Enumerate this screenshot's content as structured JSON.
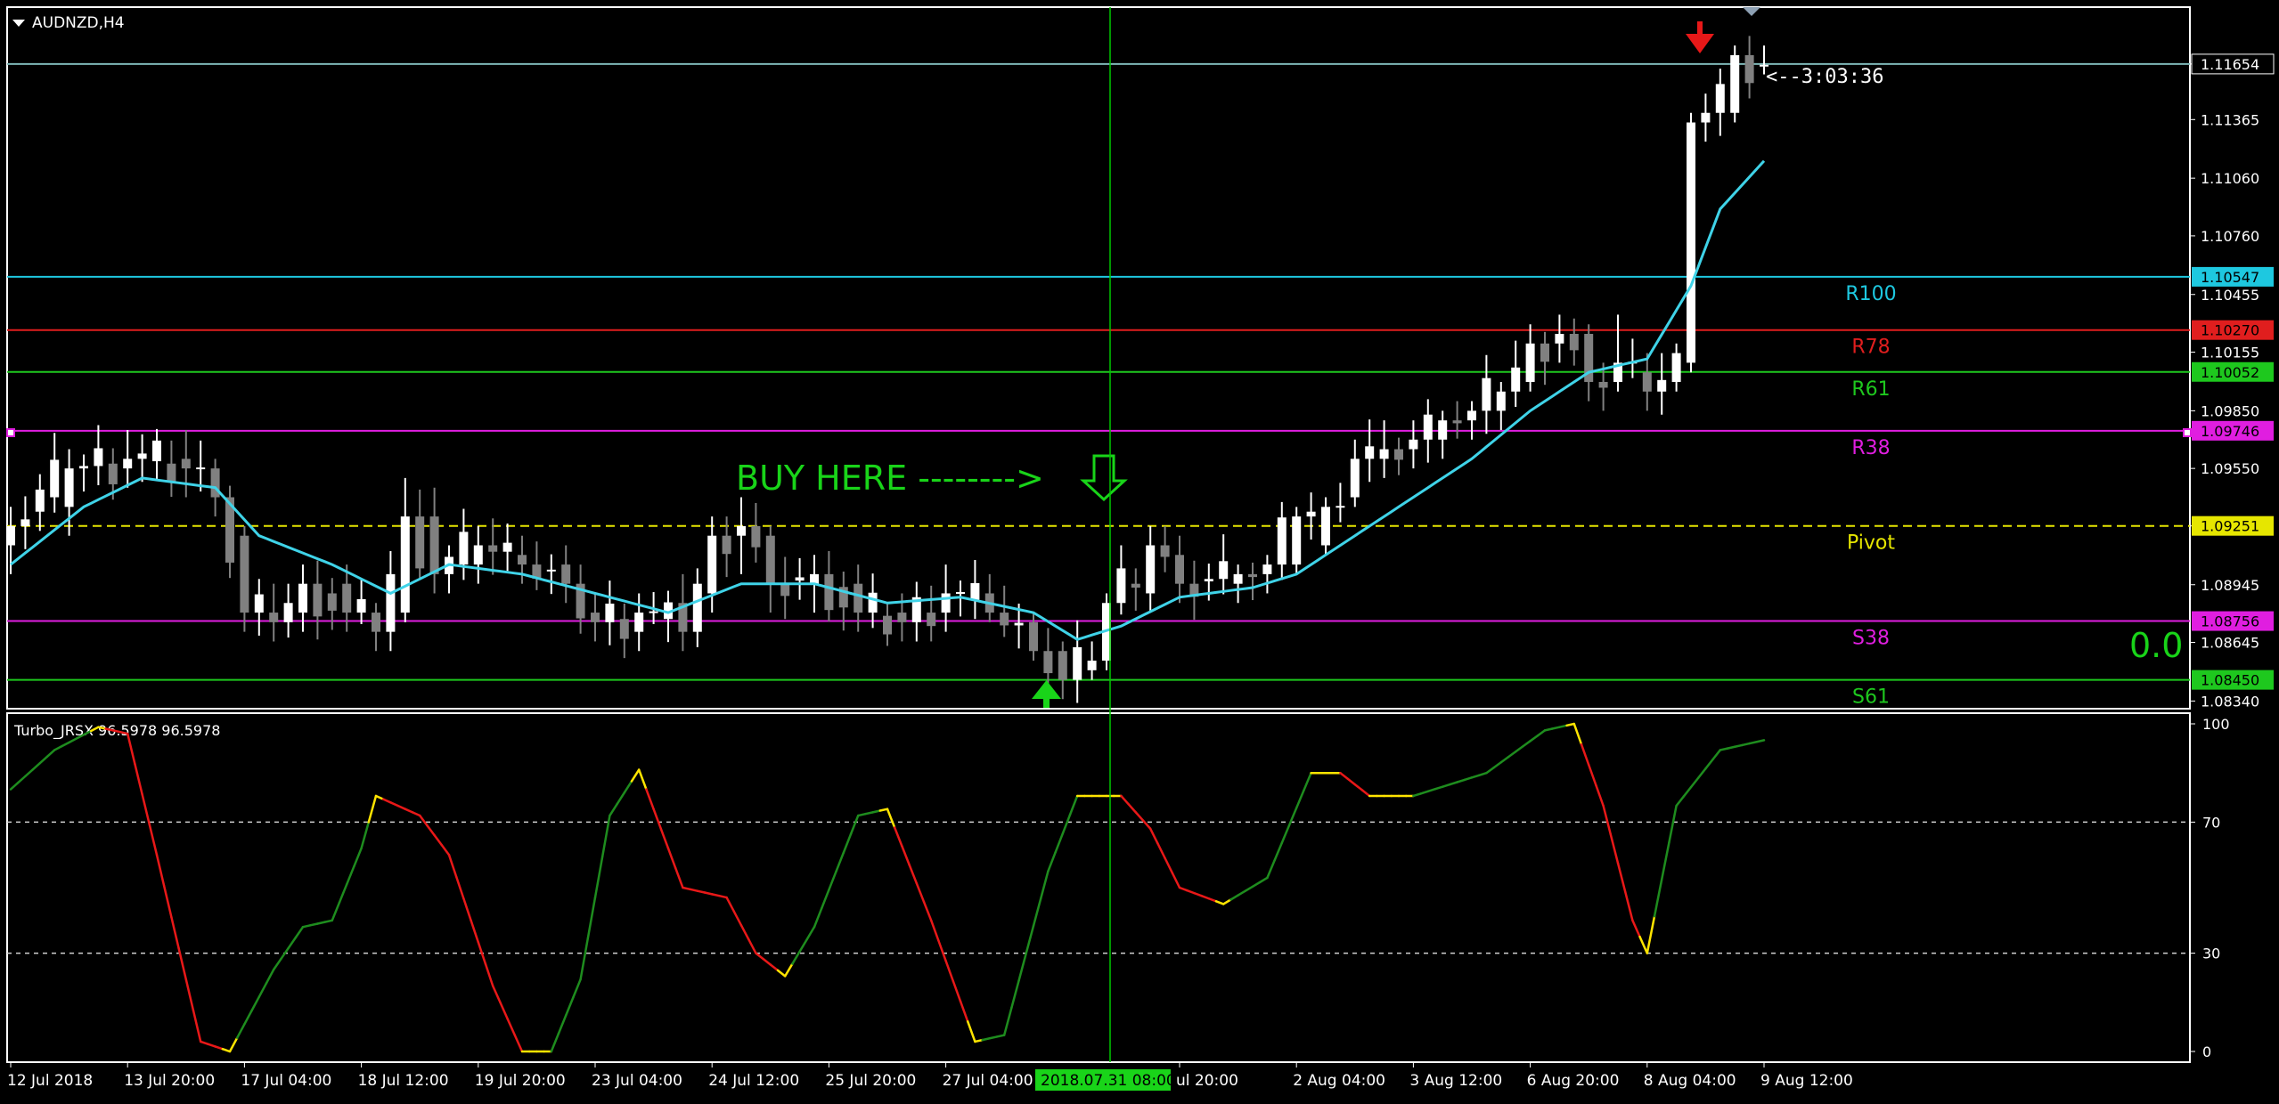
{
  "window": {
    "symbol_label": "AUDNZD,H4"
  },
  "indicator": {
    "label": "Turbo_JRSX 96.5978 96.5978"
  },
  "countdown": "<--3:03:36",
  "annotation": {
    "text": "BUY HERE -------->"
  },
  "score_text": "0.0",
  "crosshair_time_label": "2018.07.31 08:00",
  "colors": {
    "background": "#000000",
    "frame": "#ffffff",
    "bull": "#ffffff",
    "bear": "#808080",
    "ma": "#3fd3e8",
    "rsx_up": "#1e8c1e",
    "rsx_down": "#e81818",
    "rsx_turn": "#ffe400",
    "crosshair": "#00c800",
    "buy_text": "#19d419"
  },
  "price_axis": {
    "min": 1.083,
    "max": 1.1195,
    "ticks": [
      "1.11654",
      "1.11365",
      "1.11060",
      "1.10760",
      "1.10455",
      "1.10155",
      "1.09850",
      "1.09550",
      "1.09251",
      "1.08945",
      "1.08645",
      "1.08340"
    ]
  },
  "indicator_axis": {
    "min": 0,
    "max": 100,
    "ticks": [
      "100",
      "70",
      "30",
      "0"
    ]
  },
  "levels": [
    {
      "name": "bid",
      "price": 1.11654,
      "label": "",
      "tag": "1.11654",
      "color": "#7fb8b8",
      "tag_bg": "#000000",
      "tag_fg": "#ffffff",
      "dashed": false
    },
    {
      "name": "R100",
      "price": 1.10547,
      "label": "R100",
      "tag": "1.10547",
      "color": "#1ec8e0",
      "tag_bg": "#1ec8e0",
      "tag_fg": "#000000",
      "dashed": false
    },
    {
      "name": "R78",
      "price": 1.1027,
      "label": "R78",
      "tag": "1.10270",
      "color": "#e01e1e",
      "tag_bg": "#e01e1e",
      "tag_fg": "#000000",
      "dashed": false
    },
    {
      "name": "R61",
      "price": 1.10052,
      "label": "R61",
      "tag": "1.10052",
      "color": "#1ec81e",
      "tag_bg": "#1ec81e",
      "tag_fg": "#000000",
      "dashed": false
    },
    {
      "name": "R38",
      "price": 1.09746,
      "label": "R38",
      "tag": "1.09746",
      "color": "#e01ee0",
      "tag_bg": "#e01ee0",
      "tag_fg": "#000000",
      "dashed": false
    },
    {
      "name": "Pivot",
      "price": 1.09251,
      "label": "Pivot",
      "tag": "1.09251",
      "color": "#e6e600",
      "tag_bg": "#e6e600",
      "tag_fg": "#000000",
      "dashed": true
    },
    {
      "name": "S38",
      "price": 1.08756,
      "label": "S38",
      "tag": "1.08756",
      "color": "#e01ee0",
      "tag_bg": "#e01ee0",
      "tag_fg": "#000000",
      "dashed": false
    },
    {
      "name": "S61",
      "price": 1.0845,
      "label": "S61",
      "tag": "1.08450",
      "color": "#1ec81e",
      "tag_bg": "#1ec81e",
      "tag_fg": "#000000",
      "dashed": false
    }
  ],
  "time_axis": {
    "labels": [
      "12 Jul 2018",
      "13 Jul 20:00",
      "17 Jul 04:00",
      "18 Jul 12:00",
      "19 Jul 20:00",
      "23 Jul 04:00",
      "24 Jul 12:00",
      "25 Jul 20:00",
      "27 Jul 04:00",
      "ul 20:00",
      "2 Aug 04:00",
      "3 Aug 12:00",
      "6 Aug 20:00",
      "8 Aug 04:00",
      "9 Aug 12:00"
    ],
    "label_bars": [
      0,
      8,
      16,
      24,
      32,
      40,
      48,
      56,
      64,
      80,
      88,
      96,
      104,
      112,
      120
    ],
    "crosshair_bar": 75
  },
  "bars_total": 125,
  "chart_data": {
    "type": "candlestick",
    "ohlc_anchors": [
      {
        "bar": 0,
        "open": 1.0915,
        "high": 1.0935,
        "low": 1.09,
        "close": 1.0925
      },
      {
        "bar": 4,
        "open": 1.0935,
        "high": 1.0965,
        "low": 1.092,
        "close": 1.0955
      },
      {
        "bar": 8,
        "open": 1.0955,
        "high": 1.0975,
        "low": 1.0945,
        "close": 1.096
      },
      {
        "bar": 12,
        "open": 1.096,
        "high": 1.0975,
        "low": 1.094,
        "close": 1.0955
      },
      {
        "bar": 14,
        "open": 1.0955,
        "high": 1.096,
        "low": 1.093,
        "close": 1.094
      },
      {
        "bar": 16,
        "open": 1.092,
        "high": 1.0925,
        "low": 1.087,
        "close": 1.088
      },
      {
        "bar": 18,
        "open": 1.088,
        "high": 1.0895,
        "low": 1.0865,
        "close": 1.0875
      },
      {
        "bar": 20,
        "open": 1.088,
        "high": 1.0905,
        "low": 1.087,
        "close": 1.0895
      },
      {
        "bar": 23,
        "open": 1.0895,
        "high": 1.0905,
        "low": 1.087,
        "close": 1.088
      },
      {
        "bar": 25,
        "open": 1.088,
        "high": 1.0885,
        "low": 1.086,
        "close": 1.087
      },
      {
        "bar": 27,
        "open": 1.088,
        "high": 1.095,
        "low": 1.0875,
        "close": 1.093
      },
      {
        "bar": 29,
        "open": 1.093,
        "high": 1.0945,
        "low": 1.089,
        "close": 1.09
      },
      {
        "bar": 32,
        "open": 1.0905,
        "high": 1.0925,
        "low": 1.0895,
        "close": 1.0915
      },
      {
        "bar": 35,
        "open": 1.091,
        "high": 1.092,
        "low": 1.0895,
        "close": 1.0905
      },
      {
        "bar": 38,
        "open": 1.0905,
        "high": 1.0915,
        "low": 1.0885,
        "close": 1.0895
      },
      {
        "bar": 40,
        "open": 1.088,
        "high": 1.089,
        "low": 1.0865,
        "close": 1.0875
      },
      {
        "bar": 43,
        "open": 1.087,
        "high": 1.089,
        "low": 1.086,
        "close": 1.088
      },
      {
        "bar": 46,
        "open": 1.0885,
        "high": 1.09,
        "low": 1.086,
        "close": 1.087
      },
      {
        "bar": 48,
        "open": 1.089,
        "high": 1.093,
        "low": 1.088,
        "close": 1.092
      },
      {
        "bar": 50,
        "open": 1.092,
        "high": 1.094,
        "low": 1.09,
        "close": 1.0925
      },
      {
        "bar": 52,
        "open": 1.092,
        "high": 1.0925,
        "low": 1.088,
        "close": 1.0895
      },
      {
        "bar": 55,
        "open": 1.0895,
        "high": 1.091,
        "low": 1.088,
        "close": 1.09
      },
      {
        "bar": 58,
        "open": 1.0895,
        "high": 1.0905,
        "low": 1.087,
        "close": 1.088
      },
      {
        "bar": 61,
        "open": 1.088,
        "high": 1.089,
        "low": 1.0865,
        "close": 1.0875
      },
      {
        "bar": 64,
        "open": 1.088,
        "high": 1.0905,
        "low": 1.087,
        "close": 1.089
      },
      {
        "bar": 67,
        "open": 1.089,
        "high": 1.09,
        "low": 1.0875,
        "close": 1.088
      },
      {
        "bar": 70,
        "open": 1.0875,
        "high": 1.088,
        "low": 1.0855,
        "close": 1.086
      },
      {
        "bar": 72,
        "open": 1.086,
        "high": 1.0865,
        "low": 1.0835,
        "close": 1.0845
      },
      {
        "bar": 74,
        "open": 1.085,
        "high": 1.0865,
        "low": 1.0845,
        "close": 1.0855
      },
      {
        "bar": 75,
        "open": 1.0855,
        "high": 1.089,
        "low": 1.085,
        "close": 1.0885
      },
      {
        "bar": 78,
        "open": 1.089,
        "high": 1.0925,
        "low": 1.088,
        "close": 1.0915
      },
      {
        "bar": 80,
        "open": 1.091,
        "high": 1.092,
        "low": 1.0885,
        "close": 1.0895
      },
      {
        "bar": 84,
        "open": 1.0895,
        "high": 1.0905,
        "low": 1.0885,
        "close": 1.09
      },
      {
        "bar": 86,
        "open": 1.09,
        "high": 1.091,
        "low": 1.089,
        "close": 1.0905
      },
      {
        "bar": 88,
        "open": 1.0905,
        "high": 1.0935,
        "low": 1.09,
        "close": 1.093
      },
      {
        "bar": 90,
        "open": 1.0915,
        "high": 1.094,
        "low": 1.091,
        "close": 1.0935
      },
      {
        "bar": 92,
        "open": 1.094,
        "high": 1.097,
        "low": 1.0935,
        "close": 1.096
      },
      {
        "bar": 94,
        "open": 1.096,
        "high": 1.098,
        "low": 1.095,
        "close": 1.0965
      },
      {
        "bar": 96,
        "open": 1.0965,
        "high": 1.098,
        "low": 1.0955,
        "close": 1.097
      },
      {
        "bar": 98,
        "open": 1.097,
        "high": 1.0985,
        "low": 1.096,
        "close": 1.098
      },
      {
        "bar": 100,
        "open": 1.098,
        "high": 1.099,
        "low": 1.097,
        "close": 1.0985
      },
      {
        "bar": 102,
        "open": 1.0985,
        "high": 1.1,
        "low": 1.0975,
        "close": 1.0995
      },
      {
        "bar": 104,
        "open": 1.1,
        "high": 1.103,
        "low": 1.0995,
        "close": 1.102
      },
      {
        "bar": 106,
        "open": 1.102,
        "high": 1.1035,
        "low": 1.101,
        "close": 1.1025
      },
      {
        "bar": 108,
        "open": 1.1025,
        "high": 1.103,
        "low": 1.099,
        "close": 1.1
      },
      {
        "bar": 110,
        "open": 1.1,
        "high": 1.1035,
        "low": 1.0995,
        "close": 1.101
      },
      {
        "bar": 112,
        "open": 1.1005,
        "high": 1.1015,
        "low": 1.0985,
        "close": 1.0995
      },
      {
        "bar": 114,
        "open": 1.1,
        "high": 1.102,
        "low": 1.0995,
        "close": 1.1015
      },
      {
        "bar": 115,
        "open": 1.101,
        "high": 1.114,
        "low": 1.1005,
        "close": 1.1135
      },
      {
        "bar": 116,
        "open": 1.1135,
        "high": 1.115,
        "low": 1.1125,
        "close": 1.114
      },
      {
        "bar": 118,
        "open": 1.114,
        "high": 1.1175,
        "low": 1.1135,
        "close": 1.117
      },
      {
        "bar": 120,
        "open": 1.1165,
        "high": 1.1175,
        "low": 1.116,
        "close": 1.1165
      }
    ],
    "ma_anchors": [
      {
        "bar": 0,
        "value": 1.0905
      },
      {
        "bar": 5,
        "value": 1.0935
      },
      {
        "bar": 9,
        "value": 1.095
      },
      {
        "bar": 14,
        "value": 1.0945
      },
      {
        "bar": 17,
        "value": 1.092
      },
      {
        "bar": 22,
        "value": 1.0905
      },
      {
        "bar": 26,
        "value": 1.089
      },
      {
        "bar": 30,
        "value": 1.0905
      },
      {
        "bar": 35,
        "value": 1.09
      },
      {
        "bar": 40,
        "value": 1.089
      },
      {
        "bar": 45,
        "value": 1.088
      },
      {
        "bar": 50,
        "value": 1.0895
      },
      {
        "bar": 55,
        "value": 1.0895
      },
      {
        "bar": 60,
        "value": 1.0885
      },
      {
        "bar": 65,
        "value": 1.0888
      },
      {
        "bar": 70,
        "value": 1.088
      },
      {
        "bar": 73,
        "value": 1.0866
      },
      {
        "bar": 76,
        "value": 1.0873
      },
      {
        "bar": 80,
        "value": 1.0888
      },
      {
        "bar": 85,
        "value": 1.0893
      },
      {
        "bar": 88,
        "value": 1.09
      },
      {
        "bar": 92,
        "value": 1.092
      },
      {
        "bar": 96,
        "value": 1.094
      },
      {
        "bar": 100,
        "value": 1.096
      },
      {
        "bar": 104,
        "value": 1.0985
      },
      {
        "bar": 108,
        "value": 1.1005
      },
      {
        "bar": 112,
        "value": 1.1012
      },
      {
        "bar": 115,
        "value": 1.105
      },
      {
        "bar": 117,
        "value": 1.109
      },
      {
        "bar": 120,
        "value": 1.1115
      }
    ],
    "rsx_anchors": [
      {
        "bar": 0,
        "value": 80
      },
      {
        "bar": 3,
        "value": 92
      },
      {
        "bar": 6,
        "value": 99
      },
      {
        "bar": 8,
        "value": 97
      },
      {
        "bar": 10,
        "value": 60
      },
      {
        "bar": 13,
        "value": 3
      },
      {
        "bar": 15,
        "value": 0
      },
      {
        "bar": 18,
        "value": 25
      },
      {
        "bar": 20,
        "value": 38
      },
      {
        "bar": 22,
        "value": 40
      },
      {
        "bar": 24,
        "value": 62
      },
      {
        "bar": 25,
        "value": 78
      },
      {
        "bar": 28,
        "value": 72
      },
      {
        "bar": 30,
        "value": 60
      },
      {
        "bar": 33,
        "value": 20
      },
      {
        "bar": 35,
        "value": 0
      },
      {
        "bar": 37,
        "value": 0
      },
      {
        "bar": 39,
        "value": 22
      },
      {
        "bar": 41,
        "value": 72
      },
      {
        "bar": 43,
        "value": 86
      },
      {
        "bar": 46,
        "value": 50
      },
      {
        "bar": 49,
        "value": 47
      },
      {
        "bar": 51,
        "value": 30
      },
      {
        "bar": 53,
        "value": 23
      },
      {
        "bar": 55,
        "value": 38
      },
      {
        "bar": 58,
        "value": 72
      },
      {
        "bar": 60,
        "value": 74
      },
      {
        "bar": 63,
        "value": 40
      },
      {
        "bar": 66,
        "value": 3
      },
      {
        "bar": 68,
        "value": 5
      },
      {
        "bar": 71,
        "value": 55
      },
      {
        "bar": 73,
        "value": 78
      },
      {
        "bar": 76,
        "value": 78
      },
      {
        "bar": 78,
        "value": 68
      },
      {
        "bar": 80,
        "value": 50
      },
      {
        "bar": 83,
        "value": 45
      },
      {
        "bar": 86,
        "value": 53
      },
      {
        "bar": 89,
        "value": 85
      },
      {
        "bar": 91,
        "value": 85
      },
      {
        "bar": 93,
        "value": 78
      },
      {
        "bar": 96,
        "value": 78
      },
      {
        "bar": 101,
        "value": 85
      },
      {
        "bar": 105,
        "value": 98
      },
      {
        "bar": 107,
        "value": 100
      },
      {
        "bar": 109,
        "value": 75
      },
      {
        "bar": 111,
        "value": 40
      },
      {
        "bar": 112,
        "value": 30
      },
      {
        "bar": 114,
        "value": 75
      },
      {
        "bar": 117,
        "value": 92
      },
      {
        "bar": 120,
        "value": 95
      }
    ],
    "rsx_levels": [
      70,
      30
    ]
  }
}
